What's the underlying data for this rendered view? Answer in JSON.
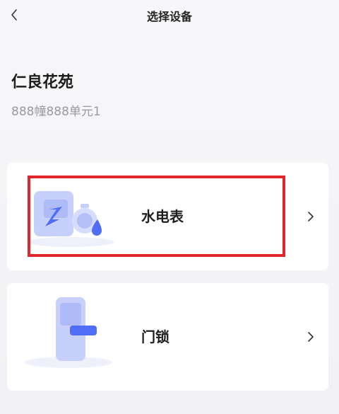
{
  "nav": {
    "title": "选择设备",
    "back_icon": "chevron-left-icon"
  },
  "location": {
    "community": "仁良花苑",
    "address": "888幢888单元1"
  },
  "devices": [
    {
      "label": "水电表",
      "icon": "meter-icon",
      "chevron": "chevron-right-icon"
    },
    {
      "label": "门锁",
      "icon": "door-lock-icon",
      "chevron": "chevron-right-icon"
    }
  ],
  "colors": {
    "highlight": "#e0262b",
    "icon_blue": "#4f6ef5",
    "icon_light": "#c7d0fb"
  }
}
